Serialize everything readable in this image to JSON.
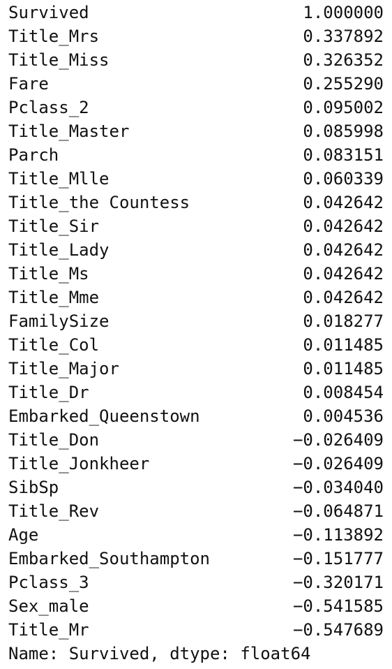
{
  "series": {
    "rows": [
      {
        "label": "Survived",
        "value": "1.000000"
      },
      {
        "label": "Title_Mrs",
        "value": "0.337892"
      },
      {
        "label": "Title_Miss",
        "value": "0.326352"
      },
      {
        "label": "Fare",
        "value": "0.255290"
      },
      {
        "label": "Pclass_2",
        "value": "0.095002"
      },
      {
        "label": "Title_Master",
        "value": "0.085998"
      },
      {
        "label": "Parch",
        "value": "0.083151"
      },
      {
        "label": "Title_Mlle",
        "value": "0.060339"
      },
      {
        "label": "Title_the Countess",
        "value": "0.042642"
      },
      {
        "label": "Title_Sir",
        "value": "0.042642"
      },
      {
        "label": "Title_Lady",
        "value": "0.042642"
      },
      {
        "label": "Title_Ms",
        "value": "0.042642"
      },
      {
        "label": "Title_Mme",
        "value": "0.042642"
      },
      {
        "label": "FamilySize",
        "value": "0.018277"
      },
      {
        "label": "Title_Col",
        "value": "0.011485"
      },
      {
        "label": "Title_Major",
        "value": "0.011485"
      },
      {
        "label": "Title_Dr",
        "value": "0.008454"
      },
      {
        "label": "Embarked_Queenstown",
        "value": "0.004536"
      },
      {
        "label": "Title_Don",
        "value": "-0.026409"
      },
      {
        "label": "Title_Jonkheer",
        "value": "-0.026409"
      },
      {
        "label": "SibSp",
        "value": "-0.034040"
      },
      {
        "label": "Title_Rev",
        "value": "-0.064871"
      },
      {
        "label": "Age",
        "value": "-0.113892"
      },
      {
        "label": "Embarked_Southampton",
        "value": "-0.151777"
      },
      {
        "label": "Pclass_3",
        "value": "-0.320171"
      },
      {
        "label": "Sex_male",
        "value": "-0.541585"
      },
      {
        "label": "Title_Mr",
        "value": "-0.547689"
      }
    ],
    "footer": "Name: Survived, dtype: float64"
  }
}
